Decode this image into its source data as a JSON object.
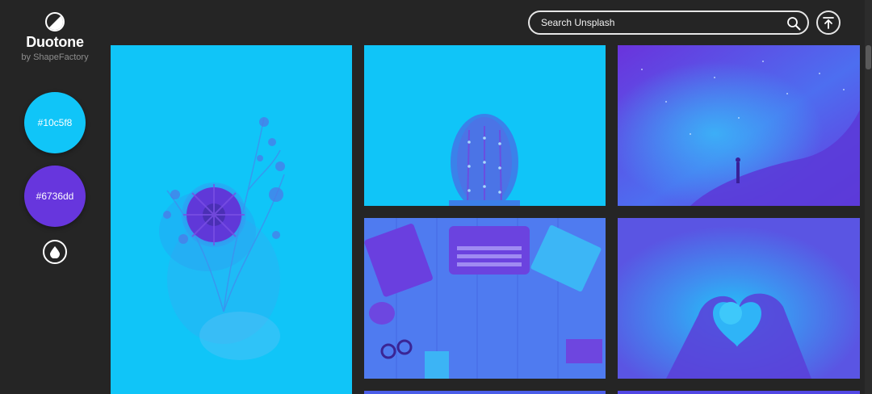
{
  "app": {
    "title": "Duotone",
    "subtitle": "by ShapeFactory"
  },
  "colors": {
    "primary": {
      "label": "#10c5f8",
      "hex": "#10c5f8"
    },
    "secondary": {
      "label": "#6736dd",
      "hex": "#6736dd"
    },
    "background": "#252525"
  },
  "search": {
    "placeholder": "Search Unsplash",
    "value": ""
  },
  "icons": {
    "logo": "half-circle-icon",
    "drop": "water-drop-icon",
    "search": "magnifier-icon",
    "top": "arrow-up-to-line-icon"
  },
  "gallery": [
    {
      "subject": "flower-bouquet"
    },
    {
      "subject": "cactus"
    },
    {
      "subject": "milky-way-night-sky"
    },
    {
      "subject": "desk-with-typewriter"
    },
    {
      "subject": "hands-heart-shape"
    }
  ]
}
